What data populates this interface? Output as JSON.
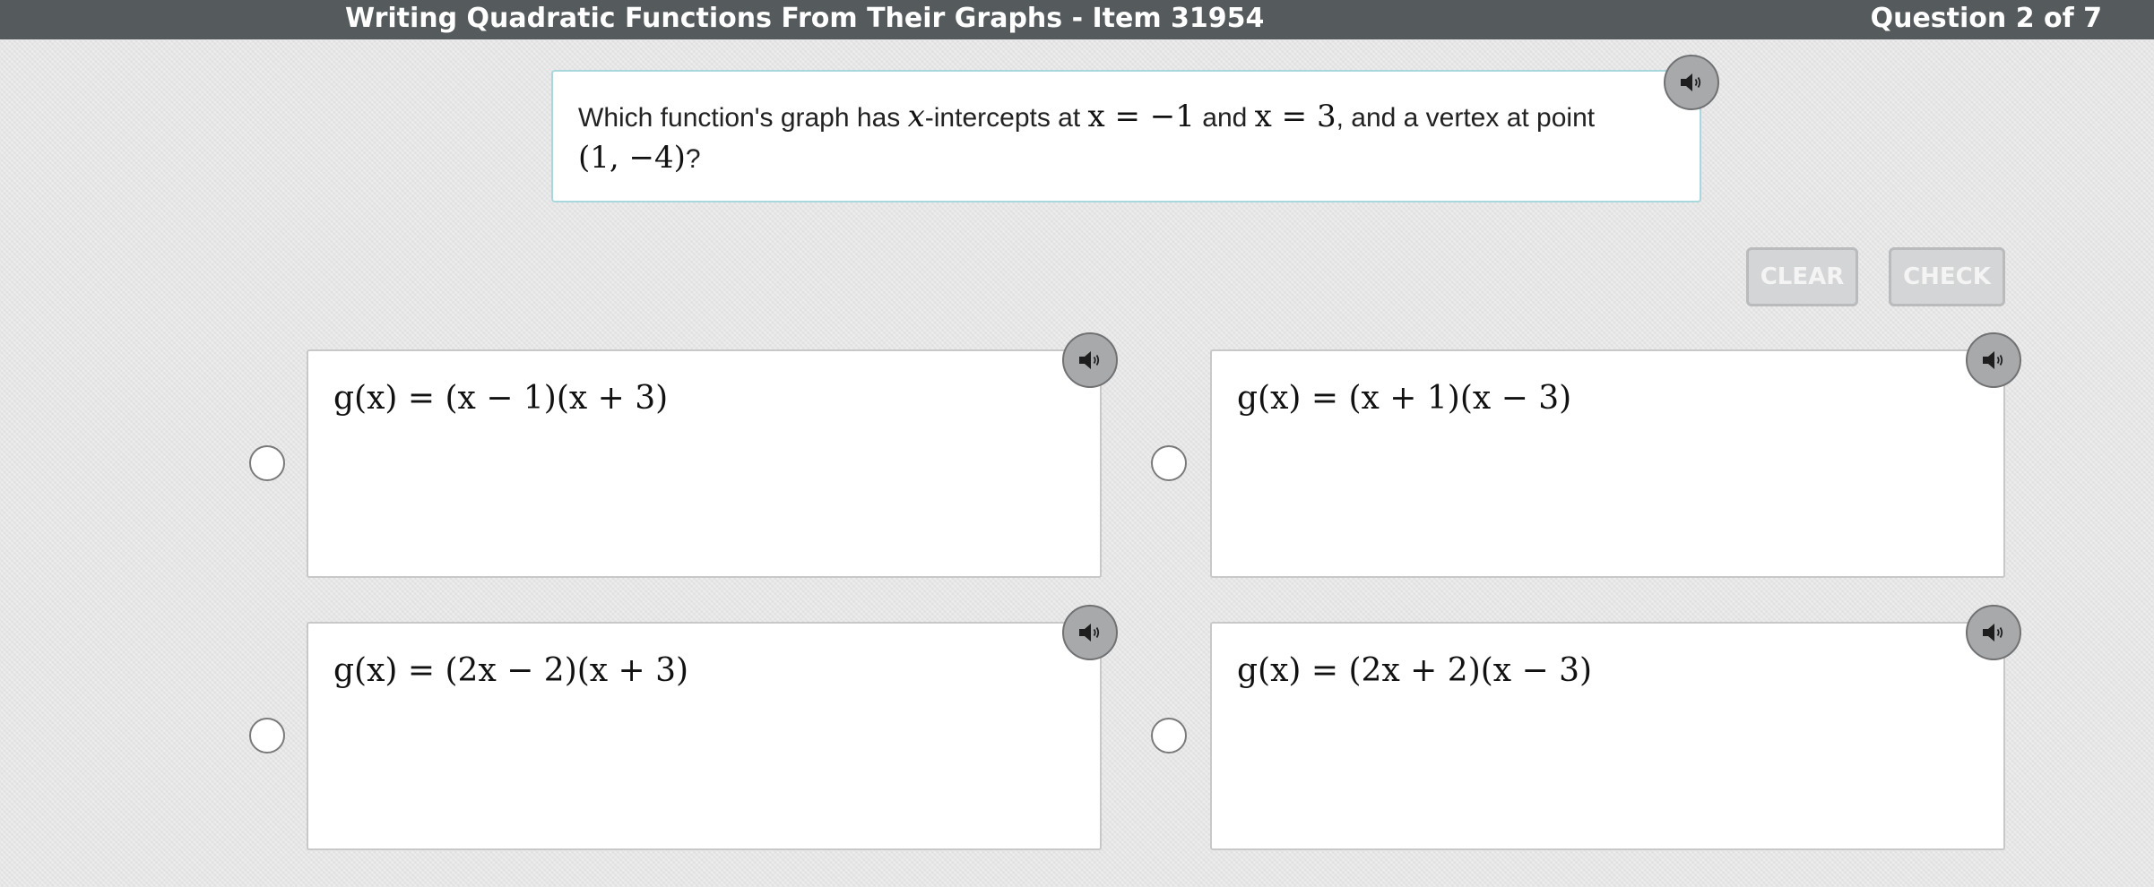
{
  "header": {
    "title": "Writing Quadratic Functions From Their Graphs - Item 31954",
    "question_counter": "Question 2 of 7"
  },
  "question": {
    "text_1": "Which function's graph has ",
    "var_x": "x",
    "text_2": "-intercepts at ",
    "eq_1": "x = −1",
    "text_3": " and ",
    "eq_2": "x = 3",
    "text_4": ", and a vertex at point",
    "point": "(1, −4)",
    "text_5": "?",
    "audio_icon": "speaker-icon"
  },
  "buttons": {
    "clear": "CLEAR",
    "check": "CHECK"
  },
  "choices": [
    {
      "formula": "g(x) = (x − 1)(x + 3)",
      "audio_icon": "speaker-icon",
      "selected": false
    },
    {
      "formula": "g(x) = (x + 1)(x − 3)",
      "audio_icon": "speaker-icon",
      "selected": false
    },
    {
      "formula": "g(x) = (2x − 2)(x + 3)",
      "audio_icon": "speaker-icon",
      "selected": false
    },
    {
      "formula": "g(x) = (2x + 2)(x − 3)",
      "audio_icon": "speaker-icon",
      "selected": false
    }
  ],
  "colors": {
    "header_bg": "#555a5c",
    "page_bg": "#e6e6e6",
    "question_border": "#a9d8dc",
    "disabled_button": "#d3d5d6",
    "audio_button": "#a7a9ab"
  }
}
